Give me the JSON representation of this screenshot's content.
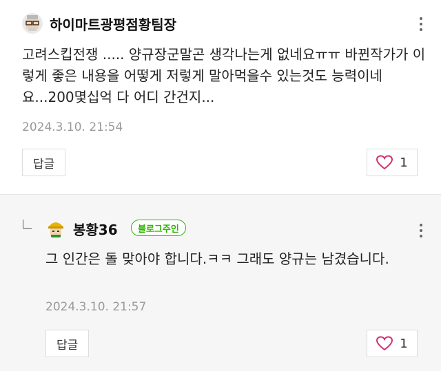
{
  "comments": [
    {
      "nickname": "하이마트광평점황팀장",
      "avatar_icon": "grandpa-avatar-icon",
      "text": "고려스킵전쟁 ..... 양규장군말곤 생각나는게 없네요ㅠㅠ 바뀐작가가 이렇게 좋은 내용을 어떻게 저렇게 말아먹을수 있는것도 능력이네요...200몇십억 다 어디 간건지...",
      "date": "2024.3.10. 21:54",
      "reply_label": "답글",
      "like_count": "1"
    },
    {
      "nickname": "봉황36",
      "avatar_icon": "helmet-avatar-icon",
      "badge": "블로그주인",
      "text": "그 인간은 돌 맞아야 합니다.ㅋㅋ 그래도 양규는 남겼습니다.",
      "date": "2024.3.10. 21:57",
      "reply_label": "답글",
      "like_count": "1"
    }
  ],
  "colors": {
    "badge_green": "#2db400",
    "like_heart": "#d0306f",
    "date_gray": "#9a9a9a"
  }
}
